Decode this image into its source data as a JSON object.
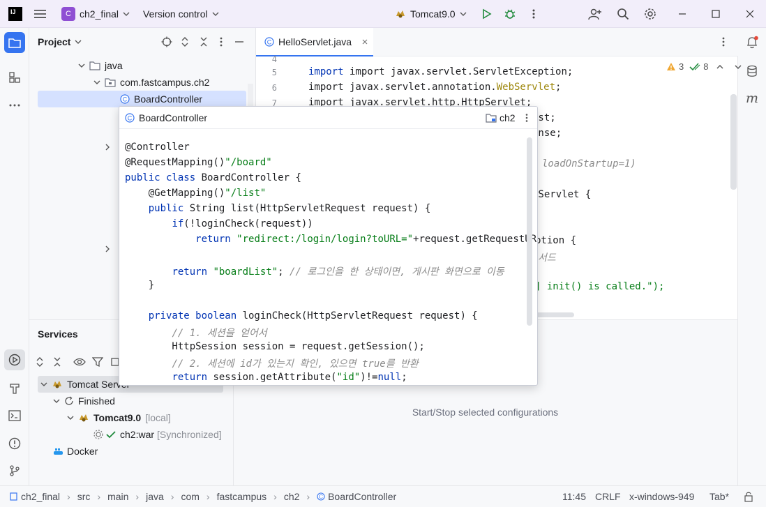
{
  "titlebar": {
    "logo_text": "IJ",
    "project_badge": "C",
    "project_name": "ch2_final",
    "vcs_label": "Version control",
    "run_config": "Tomcat9.0"
  },
  "project_panel": {
    "title": "Project",
    "tree": [
      {
        "label": "java"
      },
      {
        "label": "com.fastcampus.ch2"
      },
      {
        "label": "BoardController"
      }
    ]
  },
  "editor": {
    "tab_label": "HelloServlet.java",
    "warnings": "3",
    "checks": "8",
    "lines": [
      {
        "num": "4"
      },
      {
        "num": "5",
        "text": "import javax.servlet.ServletException;"
      },
      {
        "num": "6",
        "pre": "import javax.servlet.annotation.",
        "ann": "WebServlet",
        "post": ";"
      },
      {
        "num": "7",
        "text": "import javax.servlet.http.HttpServlet;"
      }
    ],
    "visible_fragments": [
      {
        "text": "est;"
      },
      {
        "text": "onse;"
      },
      {
        "text": "loadOnStartup=1)"
      },
      {
        "text": "pServlet {"
      },
      {
        "text": "ption {"
      },
      {
        "text": "서드"
      },
      {
        "text": "] init() is called.\");"
      }
    ]
  },
  "popup": {
    "title": "BoardController",
    "module": "ch2",
    "code": [
      {
        "text": "@Controller"
      },
      {
        "pre": "@RequestMapping(",
        "str": "\"/board\"",
        "post": ")"
      },
      {
        "kw": "public class ",
        "post": "BoardController {"
      },
      {
        "pre": "    @GetMapping(",
        "str": "\"/list\"",
        "post": ")"
      },
      {
        "pre": "    ",
        "kw": "public ",
        "post": "String list(HttpServletRequest request) {"
      },
      {
        "pre": "        ",
        "kw": "if",
        "post": "(!loginCheck(request))"
      },
      {
        "pre": "            ",
        "kw": "return ",
        "str": "\"redirect:/login/login?toURL=\"",
        "post": "+request.getRequestURL()"
      },
      {
        "text": ""
      },
      {
        "pre": "        ",
        "kw": "return ",
        "str": "\"boardList\"",
        "post": "; ",
        "cmt": "// 로그인을 한 상태이면, 게시판 화면으로 이동"
      },
      {
        "text": "    }"
      },
      {
        "text": ""
      },
      {
        "pre": "    ",
        "kw": "private boolean ",
        "post": "loginCheck(HttpServletRequest request) {"
      },
      {
        "pre": "        ",
        "cmt": "// 1. 세션을 얻어서"
      },
      {
        "text": "        HttpSession session = request.getSession();"
      },
      {
        "pre": "        ",
        "cmt": "// 2. 세션에 id가 있는지 확인, 있으면 true를 반환"
      },
      {
        "pre": "        ",
        "kw": "return ",
        "post": "session.getAttribute(",
        "str": "\"id\"",
        "post2": ")!=",
        "kw2": "null",
        "post3": ";"
      }
    ]
  },
  "services": {
    "title": "Services",
    "tree": [
      {
        "label": "Tomcat Server"
      },
      {
        "label": "Finished"
      },
      {
        "label": "Tomcat9.0",
        "tag": "[local]"
      },
      {
        "label": "ch2:war",
        "tag": "[Synchronized]"
      },
      {
        "label": "Docker"
      }
    ],
    "placeholder": "Start/Stop selected configurations"
  },
  "statusbar": {
    "breadcrumb": [
      "ch2_final",
      "src",
      "main",
      "java",
      "com",
      "fastcampus",
      "ch2",
      "BoardController"
    ],
    "position": "11:45",
    "line_sep": "CRLF",
    "encoding": "x-windows-949",
    "indent": "Tab*"
  },
  "colors": {
    "accent": "#3574f0",
    "keyword": "#0033b3",
    "string": "#067d17",
    "annotation": "#9e880d",
    "comment": "#8c8c8c",
    "run_green": "#208a3c",
    "project_badge": "#8f4fd3"
  }
}
